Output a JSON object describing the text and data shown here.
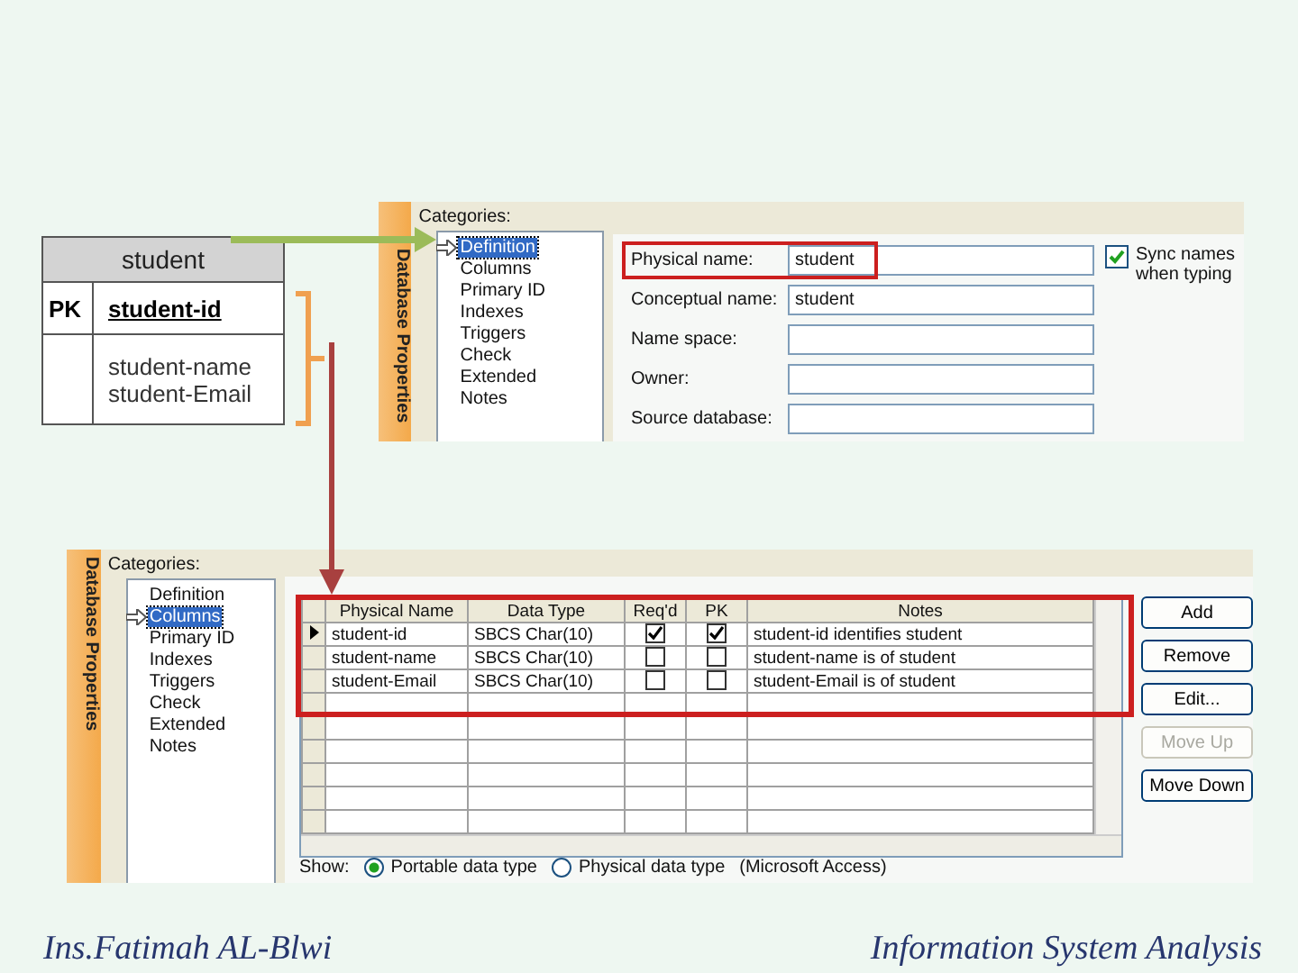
{
  "er_entity": {
    "name": "student",
    "key_label": "PK",
    "key": "student-id",
    "attributes": [
      "student-name",
      "student-Email"
    ]
  },
  "dialogs": [
    {
      "kind": "definition",
      "tab": "Database Properties",
      "categories_label": "Categories:",
      "categories": [
        {
          "label": "Definition",
          "selected": true
        },
        {
          "label": "Columns",
          "selected": false
        },
        {
          "label": "Primary ID",
          "selected": false
        },
        {
          "label": "Indexes",
          "selected": false
        },
        {
          "label": "Triggers",
          "selected": false
        },
        {
          "label": "Check",
          "selected": false
        },
        {
          "label": "Extended",
          "selected": false
        },
        {
          "label": "Notes",
          "selected": false
        }
      ],
      "fields": [
        {
          "label": "Physical name:",
          "value": "student",
          "highlighted": true
        },
        {
          "label": "Conceptual name:",
          "value": "student",
          "highlighted": false
        },
        {
          "label": "Name space:",
          "highlighted": false
        },
        {
          "label": "Owner:",
          "highlighted": false
        },
        {
          "label": "Source database:",
          "highlighted": false
        }
      ],
      "sync_checkbox": {
        "label": "Sync names when typing",
        "checked": true
      }
    },
    {
      "kind": "columns",
      "tab": "Database Properties",
      "categories_label": "Categories:",
      "categories": [
        {
          "label": "Definition",
          "selected": false
        },
        {
          "label": "Columns",
          "selected": true
        },
        {
          "label": "Primary ID",
          "selected": false
        },
        {
          "label": "Indexes",
          "selected": false
        },
        {
          "label": "Triggers",
          "selected": false
        },
        {
          "label": "Check",
          "selected": false
        },
        {
          "label": "Extended",
          "selected": false
        },
        {
          "label": "Notes",
          "selected": false
        }
      ],
      "table": {
        "highlighted": true,
        "columns": [
          "Physical Name",
          "Data Type",
          "Req'd",
          "PK",
          "Notes"
        ],
        "rows": [
          {
            "selected": true,
            "name": "student-id",
            "type": "SBCS Char(10)",
            "required": true,
            "pk": true,
            "notes": "student-id identifies student"
          },
          {
            "selected": false,
            "name": "student-name",
            "type": "SBCS Char(10)",
            "required": false,
            "pk": false,
            "notes": "student-name is of student"
          },
          {
            "selected": false,
            "name": "student-Email",
            "type": "SBCS Char(10)",
            "required": false,
            "pk": false,
            "notes": "student-Email is of student"
          }
        ]
      },
      "buttons": [
        {
          "label": "Add",
          "disabled": false
        },
        {
          "label": "Remove",
          "disabled": false
        },
        {
          "label": "Edit...",
          "disabled": false
        },
        {
          "label": "Move Up",
          "disabled": true
        },
        {
          "label": "Move Down",
          "disabled": false
        }
      ],
      "show": {
        "label": "Show:",
        "options": [
          {
            "label": "Portable data type",
            "selected": true
          },
          {
            "label": "Physical data type",
            "selected": false
          }
        ],
        "note": "(Microsoft Access)"
      }
    }
  ],
  "footer": {
    "left": "Ins.Fatimah AL-Blwi",
    "right": "Information System Analysis"
  }
}
